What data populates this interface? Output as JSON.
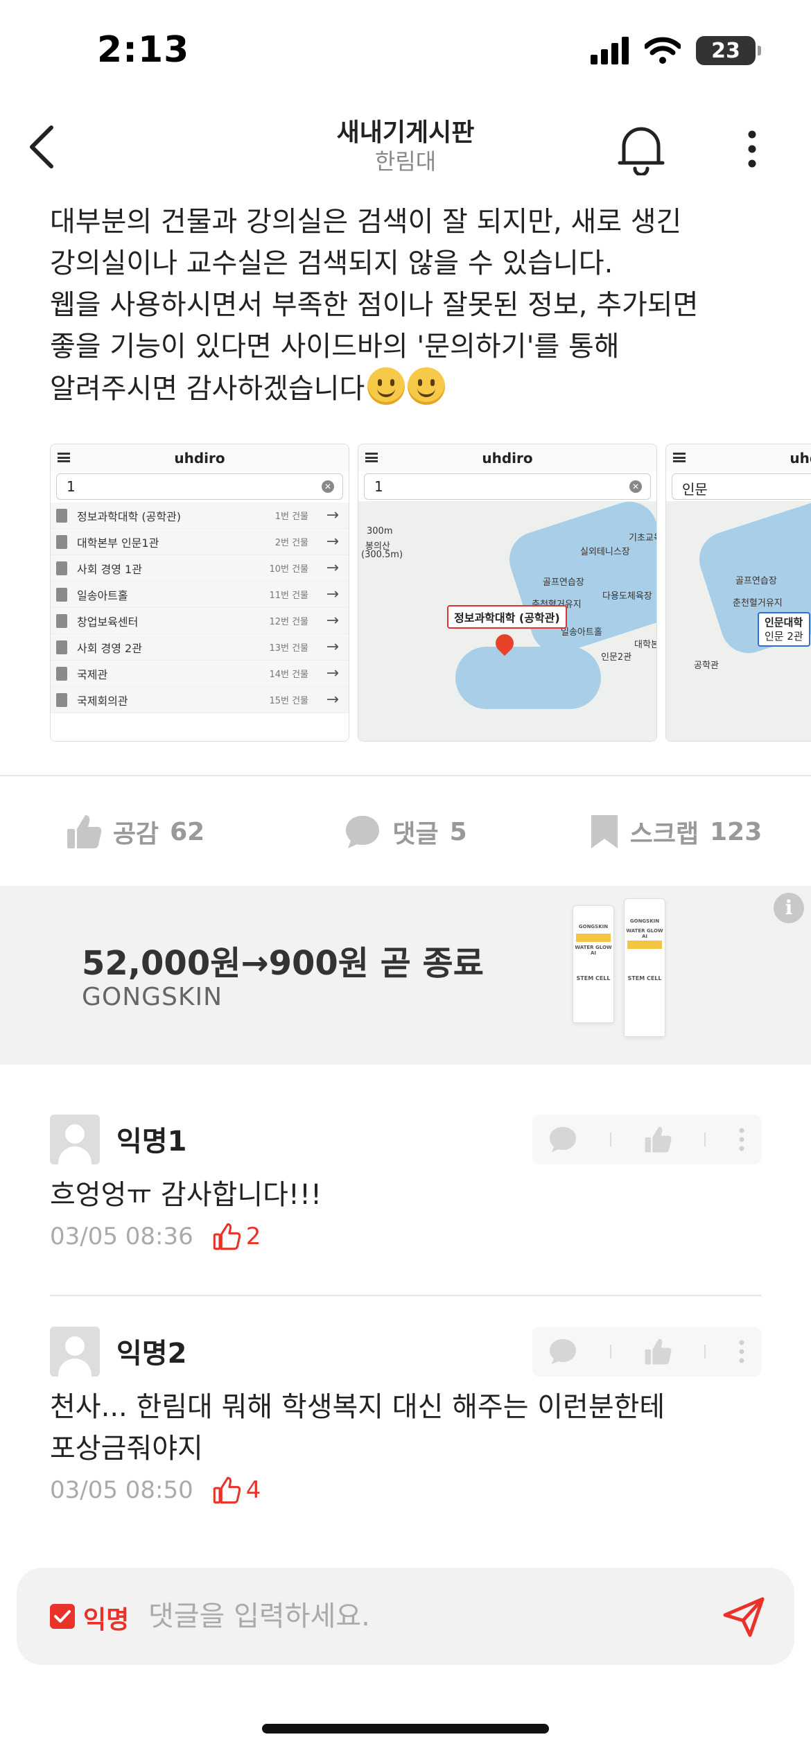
{
  "status_bar": {
    "time": "2:13",
    "battery": "23"
  },
  "header": {
    "title": "새내기게시판",
    "subtitle": "한림대"
  },
  "post": {
    "lines": [
      "대부분의 건물과 강의실은 검색이 잘 되지만, 새로 생긴",
      "강의실이나 교수실은 검색되지 않을 수 있습니다.",
      "웹을 사용하시면서 부족한 점이나 잘못된 정보, 추가되면",
      "좋을 기능이 있다면 사이드바의 '문의하기'를 통해",
      "알려주시면 감사하겠습니다"
    ],
    "images": {
      "app_title": "uhdiro",
      "shot1": {
        "query": "1",
        "results": [
          {
            "name": "정보과학대학 (공학관)",
            "num": "1번 건물"
          },
          {
            "name": "대학본부 인문1관",
            "num": "2번 건물"
          },
          {
            "name": "사회 경영 1관",
            "num": "10번 건물"
          },
          {
            "name": "일송아트홀",
            "num": "11번 건물"
          },
          {
            "name": "창업보육센터",
            "num": "12번 건물"
          },
          {
            "name": "사회 경영 2관",
            "num": "13번 건물"
          },
          {
            "name": "국제관",
            "num": "14번 건물"
          },
          {
            "name": "국제회의관",
            "num": "15번 건물"
          }
        ]
      },
      "shot2": {
        "query": "1",
        "callout": "정보과학대학 (공학관)",
        "labels": [
          "봉의산",
          "(300.5m)",
          "실외테니스장",
          "골프연습장",
          "춘천혈거유지",
          "다용도체육장",
          "일송아트홀",
          "인문2관",
          "기초교육",
          "대학본",
          "300m"
        ]
      },
      "shot3": {
        "query": "인문",
        "callout_line1": "인문대학",
        "callout_line2": "인문 2관",
        "labels": [
          "골프연습장",
          "춘천혈거유지",
          "공학관"
        ]
      }
    }
  },
  "actions": {
    "like": {
      "label": "공감",
      "count": "62"
    },
    "comment": {
      "label": "댓글",
      "count": "5"
    },
    "scrap": {
      "label": "스크랩",
      "count": "123"
    }
  },
  "ad": {
    "title": "52,000원→900원 곧 종료",
    "brand": "GONGSKIN",
    "product_text": [
      "GONGSKIN",
      "WATER GLOW AI",
      "STEM CELL"
    ]
  },
  "comments": [
    {
      "author": "익명1",
      "text": "흐엉엉ㅠ 감사합니다!!!",
      "time": "03/05 08:36",
      "likes": "2"
    },
    {
      "author": "익명2",
      "text_lines": [
        "천사... 한림대 뭐해 학생복지 대신 해주는 이런분한테",
        "포상금줘야지"
      ],
      "time": "03/05 08:50",
      "likes": "4"
    }
  ],
  "input": {
    "anon_label": "익명",
    "placeholder": "댓글을 입력하세요."
  },
  "colors": {
    "accent": "#e8322a",
    "muted": "#999999"
  }
}
